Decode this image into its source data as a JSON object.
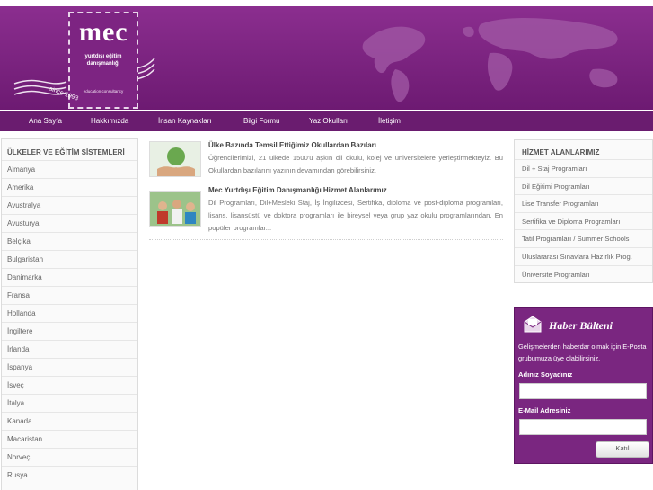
{
  "logo": {
    "brand": "mec",
    "line1": "yurtdışı eğitim",
    "line2": "danışmanlığı",
    "line3": "education consultancy",
    "year": "since 1993"
  },
  "nav": [
    "Ana Sayfa",
    "Hakkımızda",
    "İnsan Kaynakları",
    "Bilgi Formu",
    "Yaz Okulları",
    "İletişim"
  ],
  "left": {
    "title": "ÜLKELER VE EĞİTİM SİSTEMLERİ",
    "items": [
      "Almanya",
      "Amerika",
      "Avustralya",
      "Avusturya",
      "Belçika",
      "Bulgaristan",
      "Danimarka",
      "Fransa",
      "Hollanda",
      "İngiltere",
      "İrlanda",
      "İspanya",
      "İsveç",
      "İtalya",
      "Kanada",
      "Macaristan",
      "Norveç",
      "Rusya"
    ]
  },
  "articles": [
    {
      "title": "Ülke Bazında Temsil Ettiğimiz Okullardan Bazıları",
      "body": "Öğrencilerimizi, 21 ülkede 1500'ü aşkın dil okulu, kolej ve üniversitelere yerleştirmekteyiz. Bu Okullardan bazılarını yazının devamından görebilirsiniz."
    },
    {
      "title": "Mec Yurtdışı Eğitim Danışmanlığı Hizmet Alanlarımız",
      "body": "Dil Programları, Dil+Mesleki Staj, İş İngilizcesi, Sertifika, diploma ve post-diploma programları, lisans, lisansüstü ve doktora programları ile bireysel veya grup yaz okulu programlarından. En popüler programlar..."
    }
  ],
  "services": {
    "title": "HİZMET ALANLARIMIZ",
    "items": [
      "Dil + Staj Programları",
      "Dil Eğitimi Programları",
      "Lise Transfer Programları",
      "Sertifika ve Diploma Programları",
      "Tatil Programları / Summer Schools",
      "Uluslararası Sınavlara Hazırlık Prog.",
      "Üniversite Programları"
    ]
  },
  "newsletter": {
    "title": "Haber Bülteni",
    "desc": "Gelişmelerden haberdar olmak için E-Posta grubumuza üye olabilirsiniz.",
    "name_label": "Adınız Soyadınız",
    "email_label": "E-Mail Adresiniz",
    "button": "Katıl"
  },
  "colors": {
    "brand": "#7a2680",
    "nav": "#6a1c6f"
  }
}
